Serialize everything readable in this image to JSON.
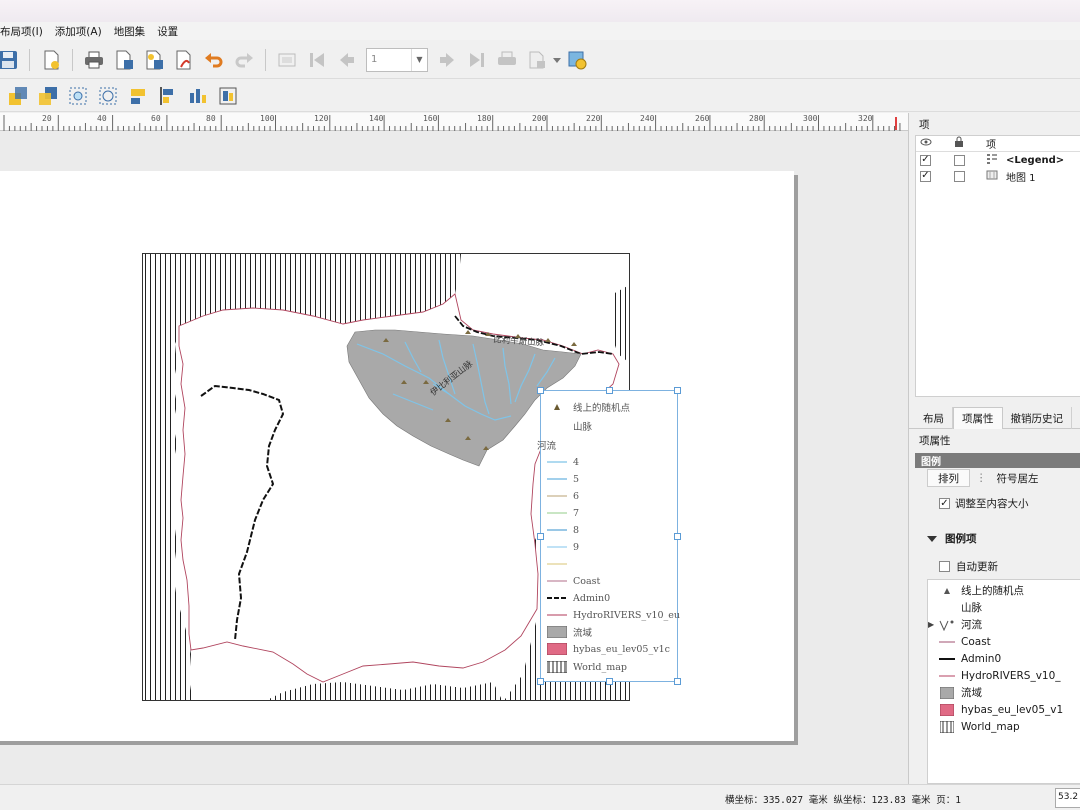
{
  "menu": [
    "布局项(I)",
    "添加项(A)",
    "地图集",
    "设置"
  ],
  "toolbar": {
    "page_number": "1"
  },
  "ruler": {
    "labels": [
      "20",
      "40",
      "60",
      "80",
      "100",
      "120",
      "140",
      "160",
      "180",
      "200",
      "220",
      "240",
      "260",
      "280",
      "300",
      "320"
    ]
  },
  "map": {
    "labels": {
      "pyrenees": "比利牛斯山脉",
      "iberian": "伊比利亚山脉"
    }
  },
  "layout_legend": {
    "rows": [
      "线上的随机点",
      "山脉",
      "河流",
      "4",
      "5",
      "6",
      "7",
      "8",
      "9",
      "",
      "Coast",
      "Admin0",
      "HydroRIVERS_v10_eu",
      "流域",
      "hybas_eu_lev05_v1c",
      "World_map"
    ],
    "river_colors": [
      "#7fc4e8",
      "#6ab4e0",
      "#c8b38f",
      "#a9d8a0",
      "#5ea8d8",
      "#9ad0f0"
    ],
    "colors": {
      "coast": "#c08aa0",
      "admin": "#111111",
      "hydro": "#c0607a",
      "basin": "#a9a9a9",
      "hybas": "#e06a85"
    }
  },
  "items_panel": {
    "title": "项",
    "col_item": "项",
    "rows": [
      {
        "label": "<Legend>",
        "checked": true
      },
      {
        "label": "地图 1",
        "checked": true
      }
    ]
  },
  "tabs": [
    "布局",
    "项属性",
    "撤销历史记"
  ],
  "properties": {
    "title": "项属性",
    "section": "图例",
    "sub_tabs": [
      "排列",
      "符号居左"
    ],
    "fit_label": "调整至内容大小",
    "group_label": "图例项",
    "auto_update": "自动更新",
    "legend_items": [
      "线上的随机点",
      "山脉",
      "河流",
      "Coast",
      "Admin0",
      "HydroRIVERS_v10_",
      "流域",
      "hybas_eu_lev05_v1",
      "World_map"
    ]
  },
  "status": {
    "text": "横坐标：335.027 毫米 纵坐标：123.83 毫米 页：1",
    "zoom": "53.2"
  }
}
